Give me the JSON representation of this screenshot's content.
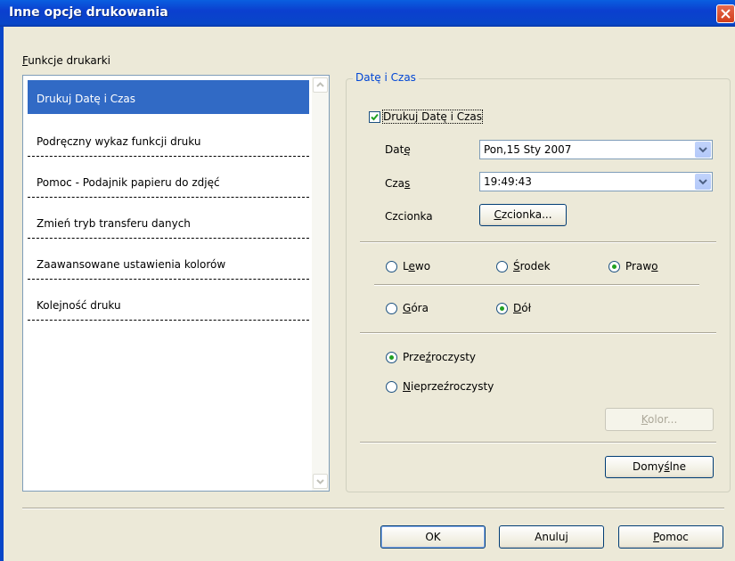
{
  "window": {
    "title": "Inne opcje drukowania"
  },
  "left": {
    "group_label_first": "F",
    "group_label_rest": "unkcje drukarki",
    "items": [
      {
        "label": "Drukuj Datę i Czas",
        "selected": true
      },
      {
        "label": "Podręczny wykaz funkcji druku"
      },
      {
        "label": "Pomoc - Podajnik papieru do zdjęć"
      },
      {
        "label": "Zmień tryb transferu danych"
      },
      {
        "label": "Zaawansowane ustawienia kolorów"
      },
      {
        "label": "Kolejność druku"
      }
    ]
  },
  "group": {
    "title": "Datę i Czas",
    "print_checkbox": {
      "label": "Drukuj Datę i Czas",
      "checked": true
    },
    "date": {
      "label_a": "Dat",
      "label_u": "ę",
      "value": "Pon,15 Sty 2007"
    },
    "time": {
      "label_a": "Cza",
      "label_u": "s",
      "value": "19:49:43"
    },
    "font": {
      "label": "Czcionka",
      "button_u": "C",
      "button_rest": "zcionka..."
    },
    "horizontal": {
      "left": {
        "a": "L",
        "u": "e",
        "b": "wo",
        "checked": false
      },
      "center": {
        "a": "",
        "u": "Ś",
        "b": "rodek",
        "checked": false
      },
      "right": {
        "a": "Praw",
        "u": "o",
        "b": "",
        "checked": true
      }
    },
    "vertical": {
      "top": {
        "a": "",
        "u": "G",
        "b": "óra",
        "checked": false
      },
      "bottom": {
        "a": "",
        "u": "D",
        "b": "ół",
        "checked": true
      }
    },
    "transparency": {
      "transparent": {
        "a": "Prze",
        "u": "ź",
        "b": "roczysty",
        "checked": true
      },
      "opaque": {
        "a": "",
        "u": "N",
        "b": "ieprzeźroczysty",
        "checked": false
      }
    },
    "color_button": {
      "u": "K",
      "rest": "olor..."
    },
    "default_button": {
      "a": "Domy",
      "u": "ś",
      "b": "lne"
    }
  },
  "footer": {
    "ok": "OK",
    "cancel": "Anuluj",
    "help_u": "P",
    "help_rest": "omoc"
  },
  "colors": {
    "title_bar": "#0846c8",
    "selection": "#316ac5",
    "group_title": "#0046d5",
    "radio_dot": "#21a121"
  }
}
